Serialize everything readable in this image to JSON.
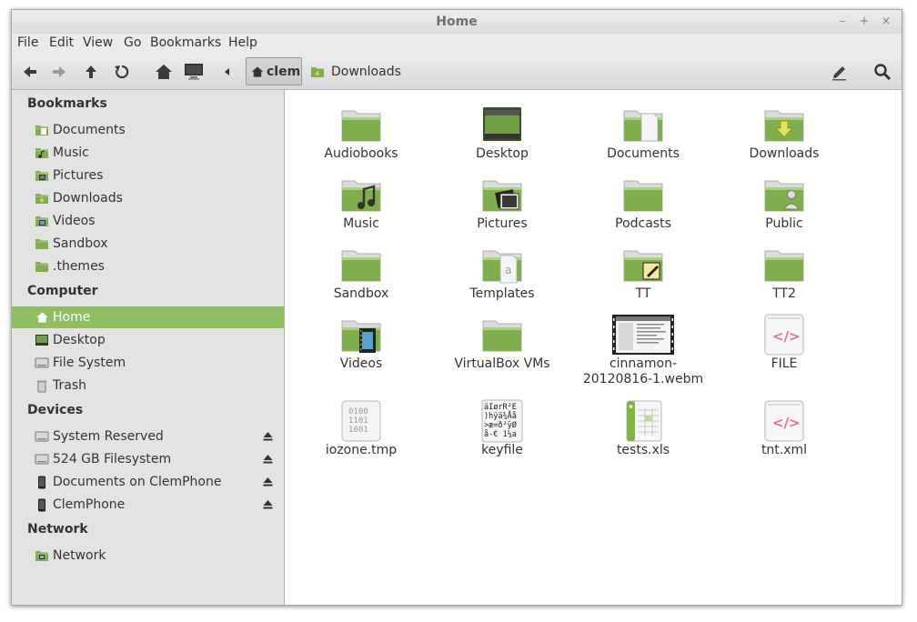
{
  "window": {
    "title": "Home"
  },
  "menu": {
    "file": "File",
    "edit": "Edit",
    "view": "View",
    "go": "Go",
    "bookmarks": "Bookmarks",
    "help": "Help"
  },
  "path": {
    "home": "clem",
    "current": "Downloads"
  },
  "sidebar": {
    "bookmarks_title": "Bookmarks",
    "bookmarks": [
      {
        "label": "Documents",
        "icon": "folder-documents-icon"
      },
      {
        "label": "Music",
        "icon": "folder-music-icon"
      },
      {
        "label": "Pictures",
        "icon": "folder-pictures-icon"
      },
      {
        "label": "Downloads",
        "icon": "folder-downloads-icon"
      },
      {
        "label": "Videos",
        "icon": "folder-videos-icon"
      },
      {
        "label": "Sandbox",
        "icon": "folder-icon"
      },
      {
        "label": ".themes",
        "icon": "folder-icon"
      }
    ],
    "computer_title": "Computer",
    "computer": [
      {
        "label": "Home",
        "icon": "home-icon"
      },
      {
        "label": "Desktop",
        "icon": "desktop-icon"
      },
      {
        "label": "File System",
        "icon": "drive-icon"
      },
      {
        "label": "Trash",
        "icon": "trash-icon"
      }
    ],
    "devices_title": "Devices",
    "devices": [
      {
        "label": "System Reserved",
        "icon": "drive-icon"
      },
      {
        "label": "524 GB Filesystem",
        "icon": "drive-icon"
      },
      {
        "label": "Documents on ClemPhone",
        "icon": "phone-icon"
      },
      {
        "label": "ClemPhone",
        "icon": "phone-icon"
      }
    ],
    "network_title": "Network",
    "network": [
      {
        "label": "Network",
        "icon": "network-icon"
      }
    ]
  },
  "files": [
    {
      "name": "Audiobooks",
      "icon": "folder-icon"
    },
    {
      "name": "Desktop",
      "icon": "folder-desktop-icon"
    },
    {
      "name": "Documents",
      "icon": "folder-documents-icon"
    },
    {
      "name": "Downloads",
      "icon": "folder-downloads-icon"
    },
    {
      "name": "Music",
      "icon": "folder-music-icon"
    },
    {
      "name": "Pictures",
      "icon": "folder-pictures-icon"
    },
    {
      "name": "Podcasts",
      "icon": "folder-icon"
    },
    {
      "name": "Public",
      "icon": "folder-public-icon"
    },
    {
      "name": "Sandbox",
      "icon": "folder-icon"
    },
    {
      "name": "Templates",
      "icon": "folder-templates-icon"
    },
    {
      "name": "TT",
      "icon": "folder-note-icon"
    },
    {
      "name": "TT2",
      "icon": "folder-icon"
    },
    {
      "name": "Videos",
      "icon": "folder-videos-icon"
    },
    {
      "name": "VirtualBox VMs",
      "icon": "folder-icon"
    },
    {
      "name": "cinnamon-\n20120816-1.webm",
      "icon": "video-file-icon"
    },
    {
      "name": "FILE",
      "icon": "xml-file-icon"
    },
    {
      "name": "iozone.tmp",
      "icon": "binary-file-icon"
    },
    {
      "name": "keyfile",
      "icon": "text-file-icon",
      "preview": [
        "äIørR²E",
        ")hÿä¾Åå",
        ">æ=ð²ÿØ",
        "å-€ 1¼a"
      ]
    },
    {
      "name": "tests.xls",
      "icon": "spreadsheet-file-icon"
    },
    {
      "name": "tnt.xml",
      "icon": "xml-file-icon"
    }
  ],
  "binary_preview": [
    "0100",
    "1101",
    "1001"
  ],
  "colors": {
    "accent": "#8fbe60",
    "folder": "#7fae4c"
  }
}
